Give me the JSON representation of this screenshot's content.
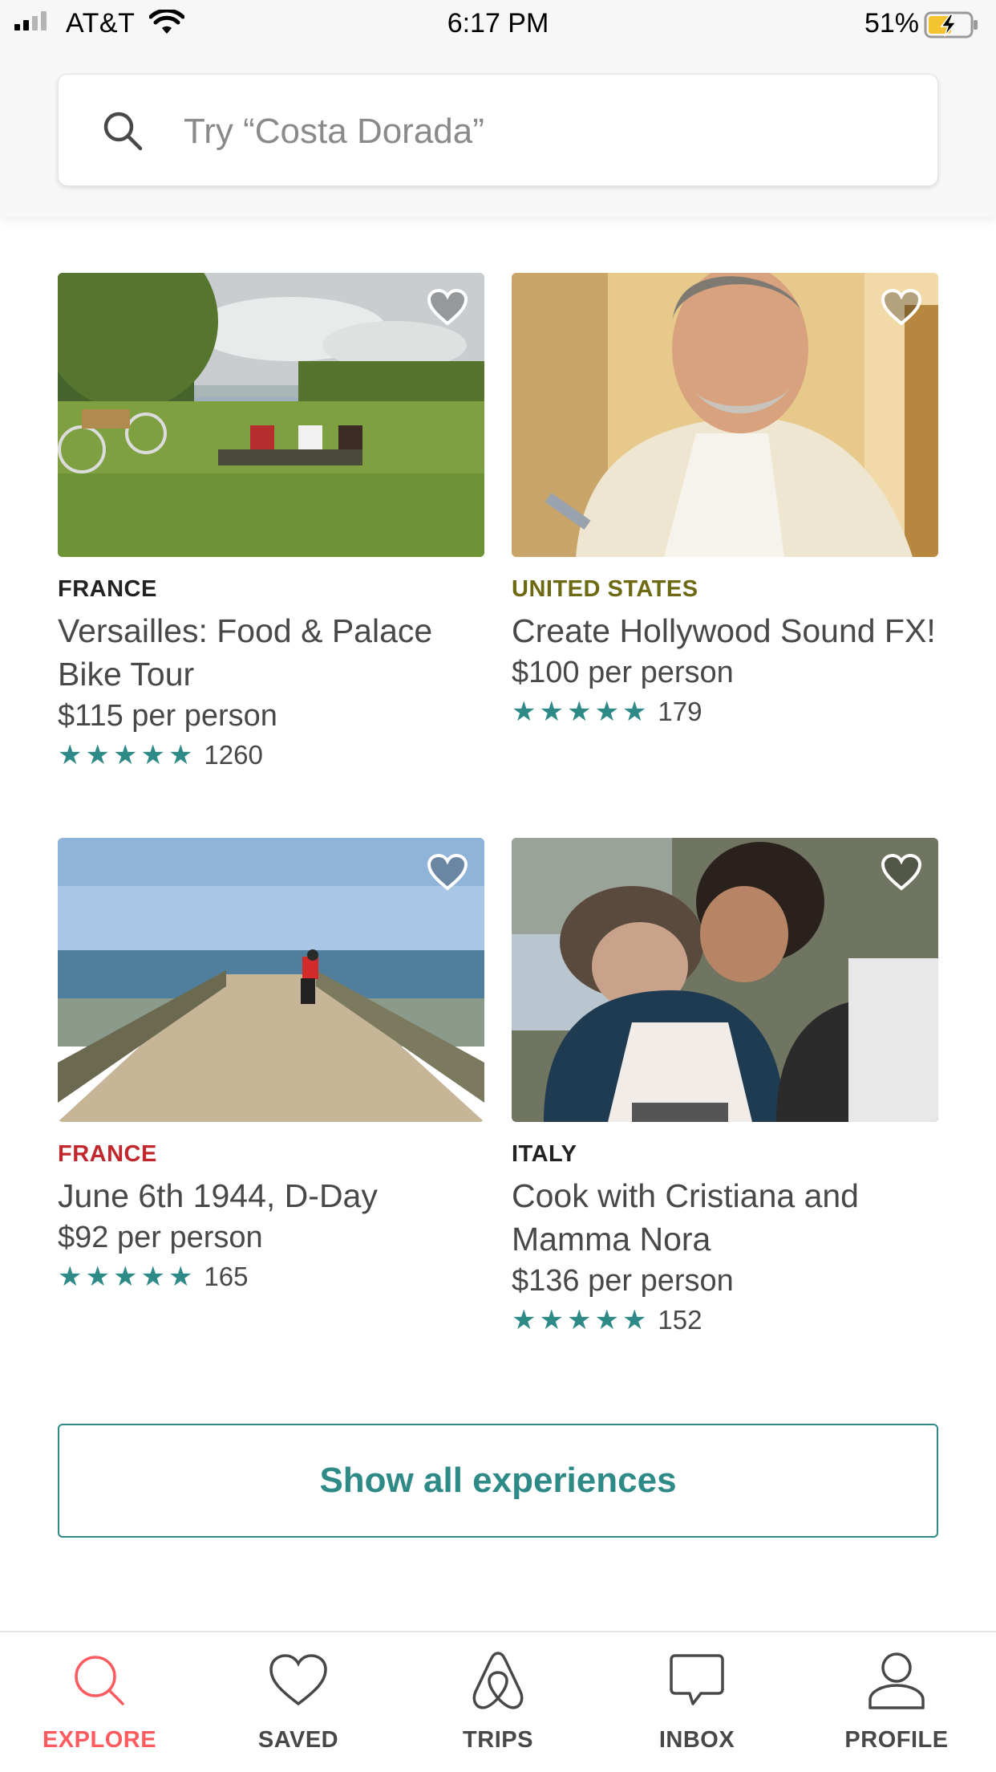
{
  "status_bar": {
    "carrier": "AT&T",
    "time": "6:17 PM",
    "battery": "51%"
  },
  "search": {
    "placeholder": "Try “Costa Dorada”"
  },
  "experiences": [
    {
      "country": "FRANCE",
      "country_color": "#222222",
      "title": "Versailles: Food & Palace Bike Tour",
      "price": "$115 per person",
      "reviews": "1260",
      "stars": 5,
      "image_icon": "picnic-photo"
    },
    {
      "country": "UNITED STATES",
      "country_color": "#6e6a14",
      "title": "Create Hollywood Sound FX!",
      "price": "$100 per person",
      "reviews": "179",
      "stars": 5,
      "image_icon": "man-photo"
    },
    {
      "country": "FRANCE",
      "country_color": "#c1272d",
      "title": "June 6th 1944, D-Day",
      "price": "$92 per person",
      "reviews": "165",
      "stars": 5,
      "image_icon": "pier-photo"
    },
    {
      "country": "ITALY",
      "country_color": "#222222",
      "title": "Cook with Cristiana and Mamma Nora",
      "price": "$136 per person",
      "reviews": "152",
      "stars": 5,
      "image_icon": "cooking-photo"
    }
  ],
  "show_all_label": "Show all experiences",
  "tabs": [
    {
      "label": "EXPLORE",
      "icon": "search-icon",
      "active": true
    },
    {
      "label": "SAVED",
      "icon": "heart-icon",
      "active": false
    },
    {
      "label": "TRIPS",
      "icon": "airbnb-logo-icon",
      "active": false
    },
    {
      "label": "INBOX",
      "icon": "chat-bubble-icon",
      "active": false
    },
    {
      "label": "PROFILE",
      "icon": "person-icon",
      "active": false
    }
  ],
  "colors": {
    "accent": "#2e8a87",
    "brand": "#ff5a5f"
  }
}
